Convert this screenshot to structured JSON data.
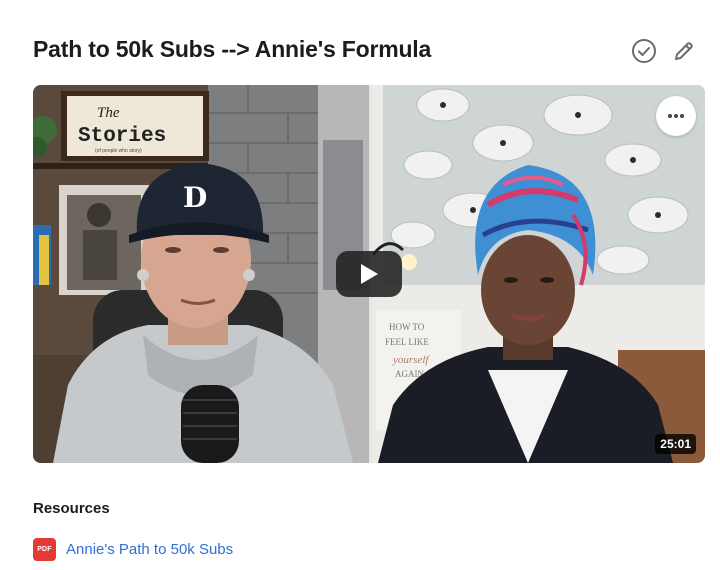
{
  "header": {
    "title": "Path to 50k Subs --> Annie's Formula",
    "complete_icon": "check-circle-icon",
    "edit_icon": "pencil-icon"
  },
  "video": {
    "duration": "25:01",
    "play_icon": "play-icon",
    "more_icon": "more-horizontal-icon",
    "sign_lines": [
      "The",
      "Stories"
    ],
    "sign_small": "(of people who story)",
    "cap_logo": "D",
    "book_lines": [
      "HOW TO",
      "FEEL LIKE",
      "yourself",
      "AGAIN"
    ]
  },
  "resources": {
    "heading": "Resources",
    "items": [
      {
        "badge": "PDF",
        "label": "Annie's Path to 50k Subs"
      }
    ]
  },
  "colors": {
    "pdf_badge": "#e53935",
    "link": "#2f6fd6",
    "icon_gray": "#6b6b6b"
  }
}
